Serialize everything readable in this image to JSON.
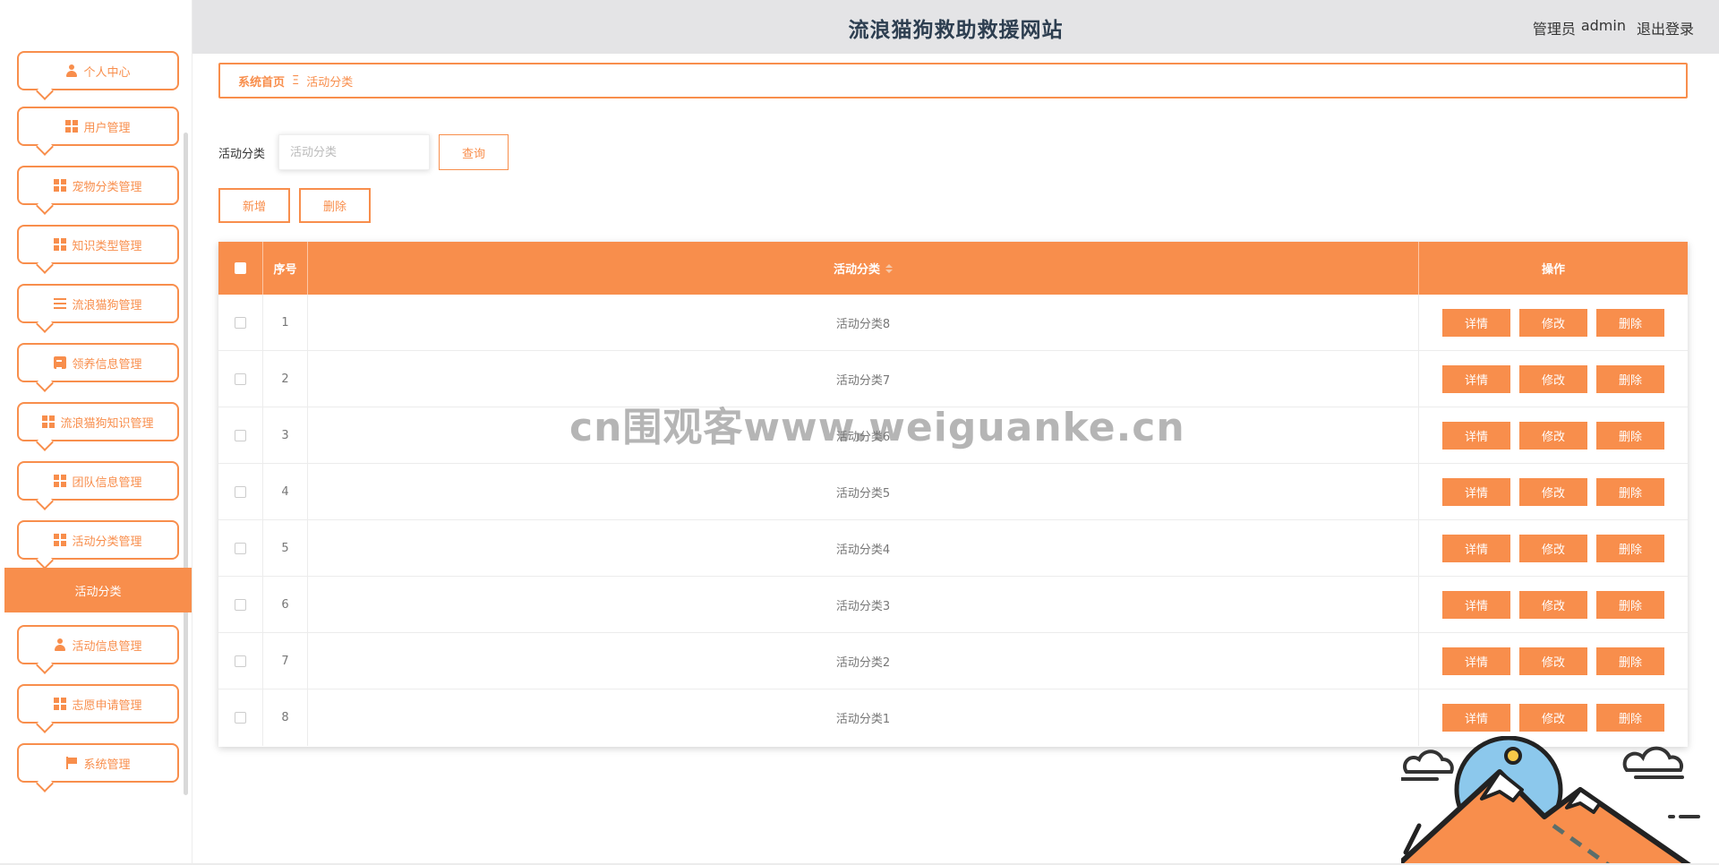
{
  "header": {
    "title": "流浪猫狗救助救援网站",
    "role_label": "管理员",
    "username": "admin",
    "logout_label": "退出登录"
  },
  "sidebar": {
    "items": [
      {
        "label": "个人中心",
        "icon": "user-icon"
      },
      {
        "label": "用户管理",
        "icon": "grid-icon"
      },
      {
        "label": "宠物分类管理",
        "icon": "grid-icon"
      },
      {
        "label": "知识类型管理",
        "icon": "grid-icon"
      },
      {
        "label": "流浪猫狗管理",
        "icon": "list-icon"
      },
      {
        "label": "领养信息管理",
        "icon": "clipboard-icon"
      },
      {
        "label": "流浪猫狗知识管理",
        "icon": "grid-icon"
      },
      {
        "label": "团队信息管理",
        "icon": "grid-icon"
      },
      {
        "label": "活动分类管理",
        "icon": "grid-icon"
      },
      {
        "label": "活动信息管理",
        "icon": "user-icon"
      },
      {
        "label": "志愿申请管理",
        "icon": "grid-icon"
      },
      {
        "label": "系统管理",
        "icon": "flag-icon"
      }
    ],
    "active_sub_item": "活动分类"
  },
  "breadcrumb": {
    "home": "系统首页",
    "separator": "Ξ",
    "current": "活动分类"
  },
  "search": {
    "label": "活动分类",
    "placeholder": "活动分类",
    "value": "",
    "query_button": "查询"
  },
  "actions": {
    "add_button": "新增",
    "delete_button": "删除"
  },
  "table": {
    "columns": [
      "序号",
      "活动分类",
      "操作"
    ],
    "row_buttons": {
      "detail": "详情",
      "edit": "修改",
      "delete": "删除"
    },
    "rows": [
      {
        "no": "1",
        "name": "活动分类8"
      },
      {
        "no": "2",
        "name": "活动分类7"
      },
      {
        "no": "3",
        "name": "活动分类6"
      },
      {
        "no": "4",
        "name": "活动分类5"
      },
      {
        "no": "5",
        "name": "活动分类4"
      },
      {
        "no": "6",
        "name": "活动分类3"
      },
      {
        "no": "7",
        "name": "活动分类2"
      },
      {
        "no": "8",
        "name": "活动分类1"
      }
    ]
  },
  "watermark": "cn围观客www.weiguanke.cn",
  "colors": {
    "accent": "#f88e4c",
    "header_bg": "#e4e4e6",
    "title_text": "#2d3e50"
  }
}
